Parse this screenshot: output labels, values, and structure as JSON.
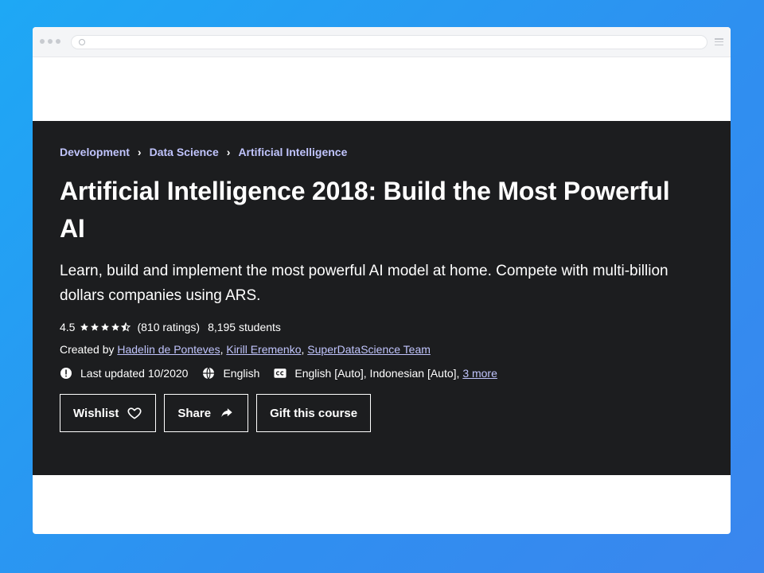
{
  "breadcrumb": [
    "Development",
    "Data Science",
    "Artificial Intelligence"
  ],
  "course": {
    "title": "Artificial Intelligence 2018: Build the Most Powerful AI",
    "subtitle": "Learn, build and implement the most powerful AI model at home. Compete with multi-billion dollars companies using ARS.",
    "rating": "4.5",
    "rating_value": 4.5,
    "ratings_count": "(810 ratings)",
    "students": "8,195 students",
    "created_by_label": "Created by",
    "authors": [
      "Hadelin de Ponteves",
      "Kirill Eremenko",
      "SuperDataScience Team"
    ],
    "last_updated": "Last updated 10/2020",
    "language": "English",
    "captions": "English [Auto], Indonesian [Auto],",
    "captions_more": "3 more"
  },
  "actions": {
    "wishlist": "Wishlist",
    "share": "Share",
    "gift": "Gift this course"
  },
  "icons": {
    "update": "alert-badge-icon",
    "language": "globe-icon",
    "captions": "closed-captions-icon",
    "wishlist": "heart-icon",
    "share": "share-arrow-icon"
  },
  "colors": {
    "background": "#1ea8f5",
    "hero": "#1c1d1f",
    "link": "#c0c4fc"
  }
}
